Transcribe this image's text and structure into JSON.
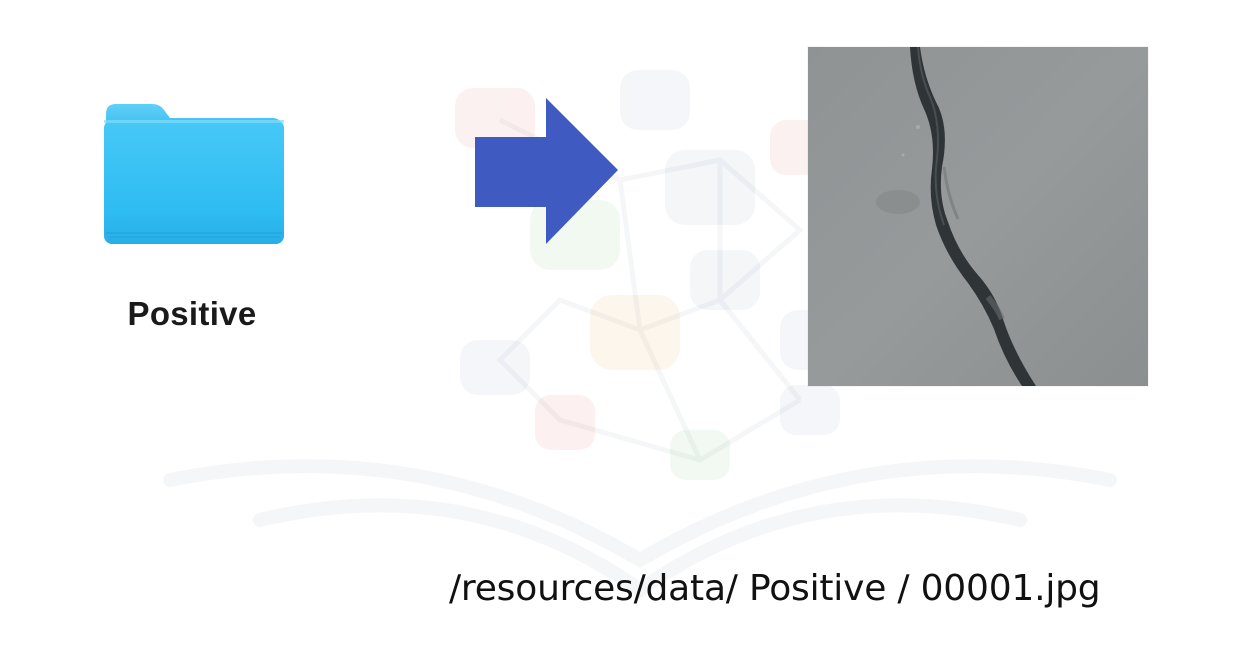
{
  "folder": {
    "label": "Positive",
    "icon": "folder-icon",
    "color": "#3bc2f4"
  },
  "arrow": {
    "icon": "right-arrow-icon",
    "color": "#3f5ac0"
  },
  "image": {
    "description_icon": "crack-thumbnail",
    "background_color": "#8e9292"
  },
  "path": {
    "text": "/resources/data/ Positive / 00001.jpg"
  }
}
